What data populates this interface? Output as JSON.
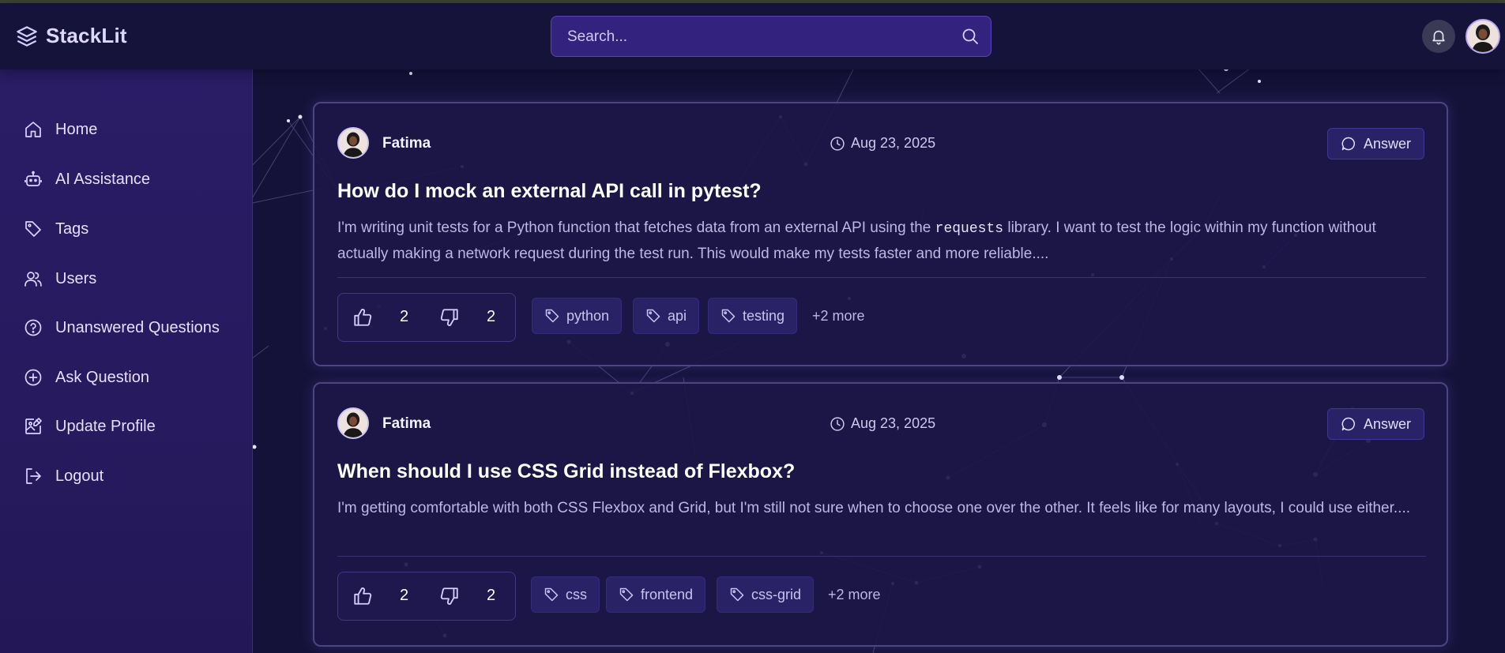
{
  "app": {
    "name": "StackLit"
  },
  "search": {
    "placeholder": "Search..."
  },
  "sidebar": {
    "items": [
      {
        "label": "Home",
        "icon": "home-icon"
      },
      {
        "label": "AI Assistance",
        "icon": "robot-icon"
      },
      {
        "label": "Tags",
        "icon": "tag-icon"
      },
      {
        "label": "Users",
        "icon": "users-icon"
      },
      {
        "label": "Unanswered Questions",
        "icon": "question-circle-icon"
      },
      {
        "label": "Ask Question",
        "icon": "plus-circle-icon"
      },
      {
        "label": "Update Profile",
        "icon": "image-edit-icon"
      },
      {
        "label": "Logout",
        "icon": "logout-icon"
      }
    ]
  },
  "questions": [
    {
      "author": "Fatima",
      "date": "Aug 23, 2025",
      "answer_label": "Answer",
      "title": "How do I mock an external API call in pytest?",
      "body_before_code": "I'm writing unit tests for a Python function that fetches data from an external API using the ",
      "body_code": "requests",
      "body_after_code": " library. I want to test the logic within my function without actually making a network request during the test run. This would make my tests faster and more reliable....",
      "upvotes": "2",
      "downvotes": "2",
      "tags": [
        "python",
        "api",
        "testing"
      ],
      "more_tags": "+2 more"
    },
    {
      "author": "Fatima",
      "date": "Aug 23, 2025",
      "answer_label": "Answer",
      "title": "When should I use CSS Grid instead of Flexbox?",
      "body": "I'm getting comfortable with both CSS Flexbox and Grid, but I'm still not sure when to choose one over the other. It feels like for many layouts, I could use either....",
      "upvotes": "2",
      "downvotes": "2",
      "tags": [
        "css",
        "frontend",
        "css-grid"
      ],
      "more_tags": "+2 more"
    }
  ],
  "colors": {
    "background": "#15123a",
    "sidebar": "#2a1c66",
    "search_bg": "#34237e",
    "card_bg": "#1c1748",
    "accent": "#5a45b8"
  }
}
